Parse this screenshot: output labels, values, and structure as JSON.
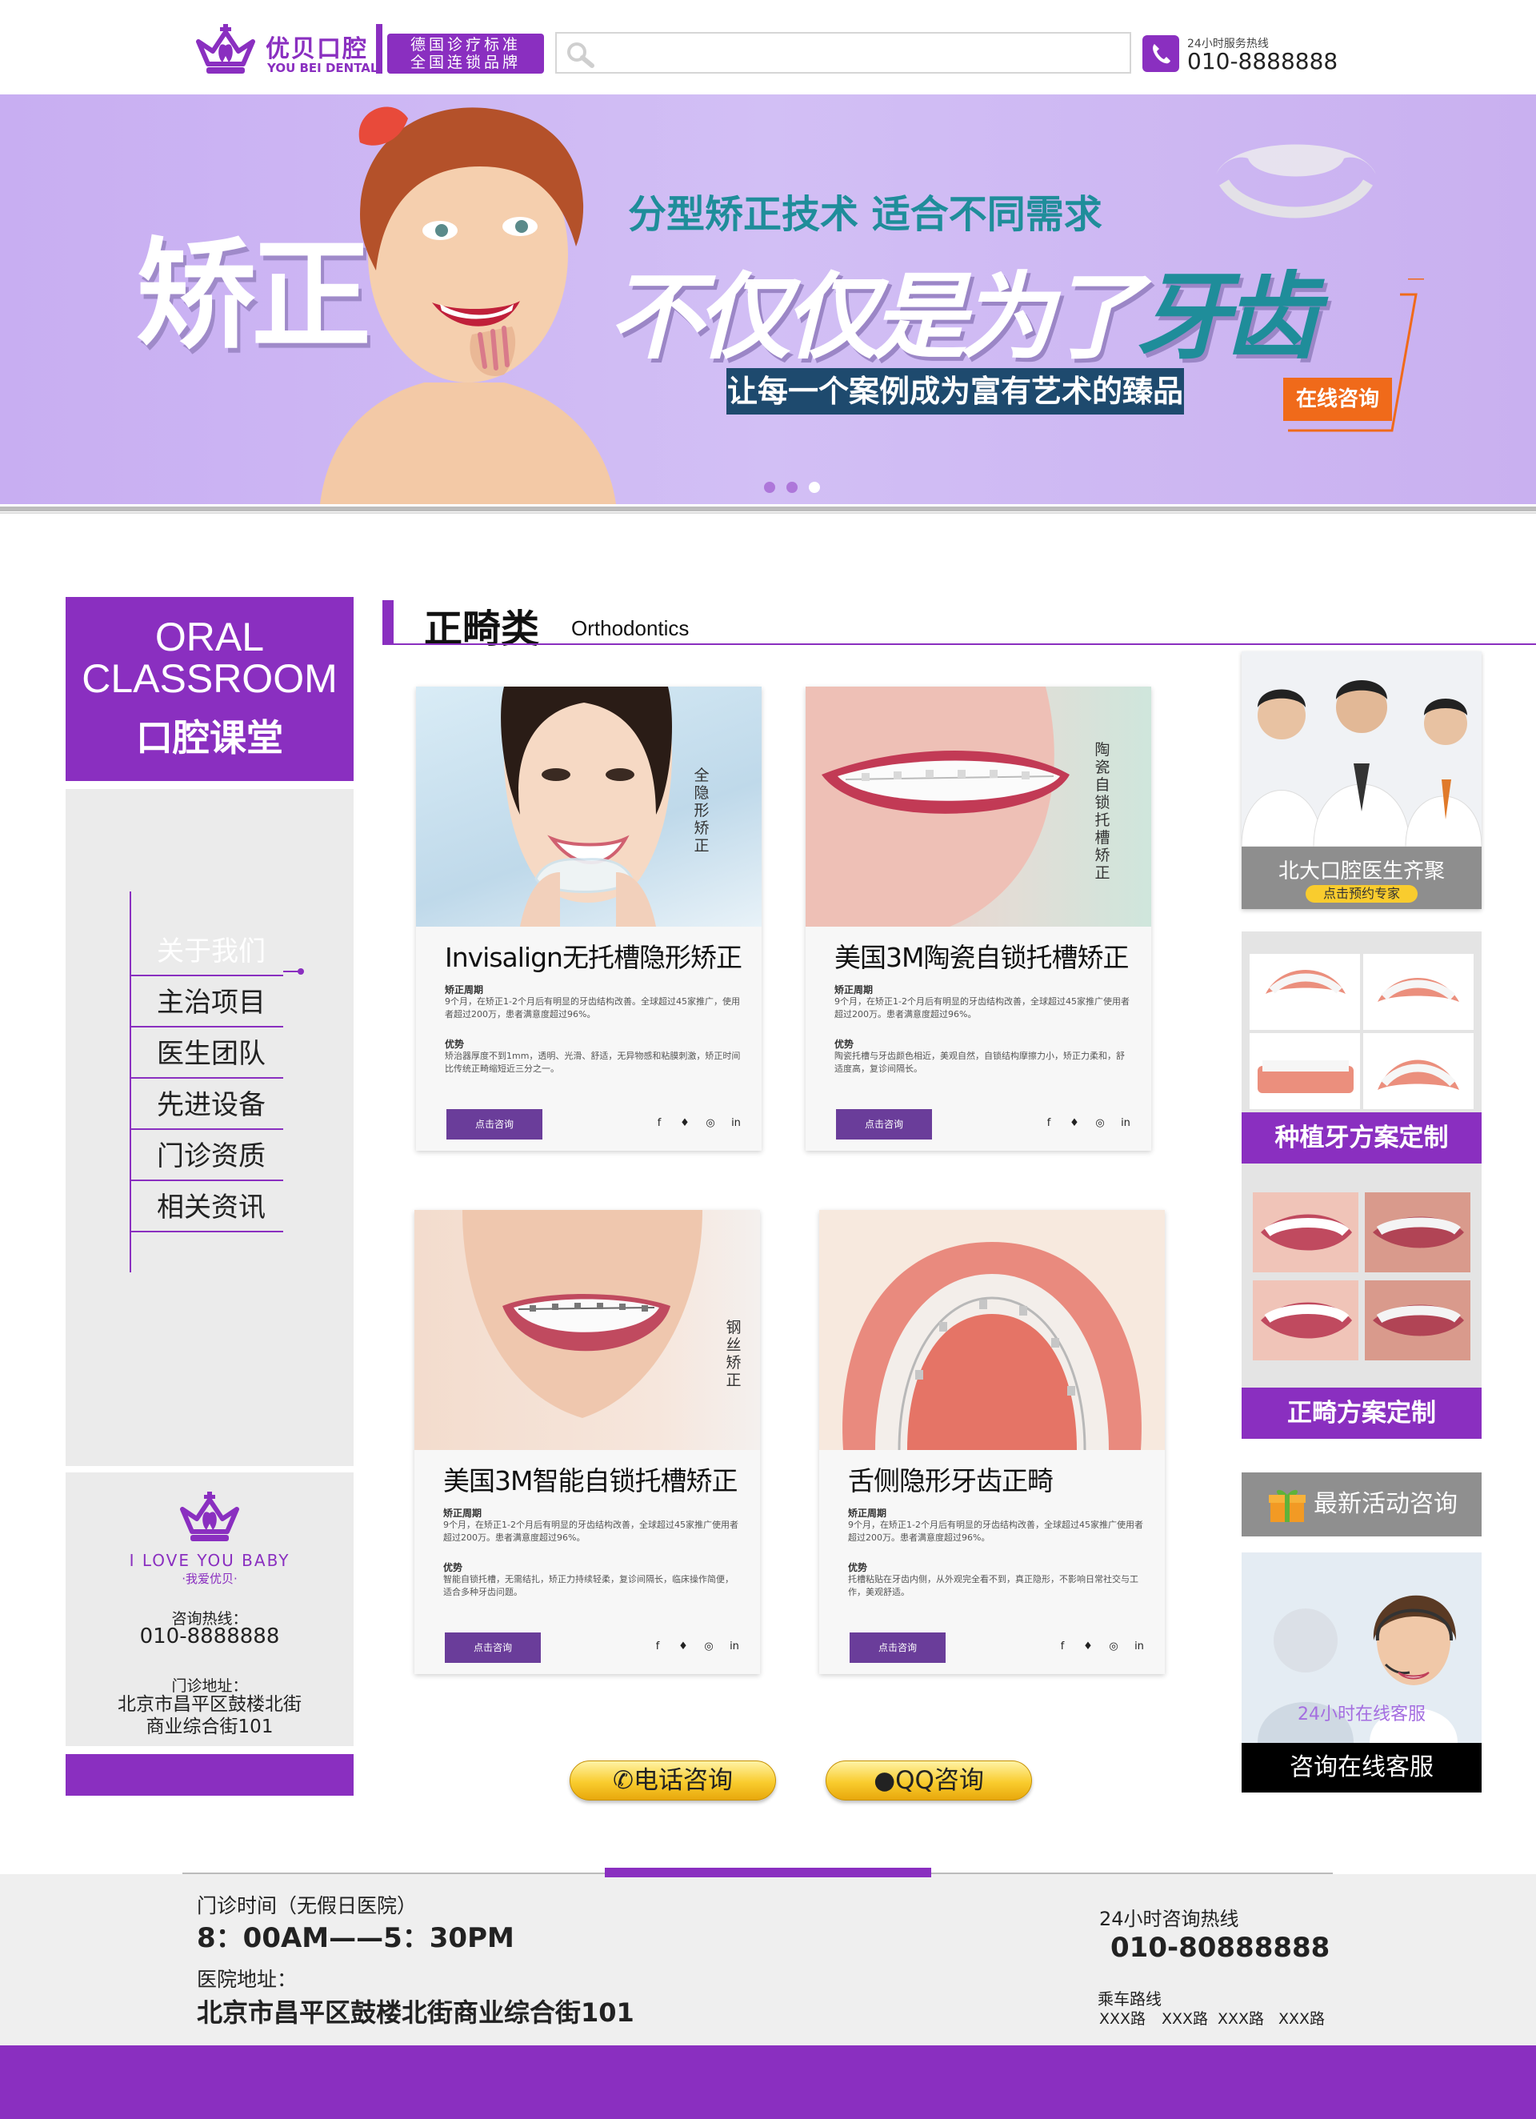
{
  "header": {
    "logo_cn": "优贝口腔",
    "logo_en": "YOU BEI DENTAL",
    "slogan_line1": "德国诊疗标准",
    "slogan_line2": "全国连锁品牌",
    "search_placeholder": "",
    "hotline_label": "24小时服务热线",
    "hotline_number": "010-8888888"
  },
  "banner": {
    "big_left": "矫正",
    "subtitle": "分型矫正技术  适合不同需求",
    "headline_part1": "不仅仅是为了",
    "headline_part2": "牙齿",
    "tagline": "让每一个案例成为富有艺术的臻品",
    "cta": "在线咨询",
    "dots": 3,
    "active_dot": 3
  },
  "sidebar": {
    "classroom_en_line1": "ORAL",
    "classroom_en_line2": "CLASSROOM",
    "classroom_cn": "口腔课堂",
    "nav": [
      {
        "label": "关于我们",
        "active": true
      },
      {
        "label": "主治项目",
        "active": false
      },
      {
        "label": "医生团队",
        "active": false
      },
      {
        "label": "先进设备",
        "active": false
      },
      {
        "label": "门诊资质",
        "active": false
      },
      {
        "label": "相关资讯",
        "active": false
      }
    ],
    "contact": {
      "tag": "I LOVE YOU BABY",
      "tag_cn": "·我爱优贝·",
      "hotline_label": "咨询热线：",
      "hotline": "010-8888888",
      "address_label": "门诊地址：",
      "address_line1": "北京市昌平区鼓楼北街",
      "address_line2": "商业综合街101"
    }
  },
  "section": {
    "title": "正畸类",
    "subtitle": "Orthodontics"
  },
  "cards": [
    {
      "vtag": "全隐形矫正",
      "title": "Invisalign无托槽隐形矫正",
      "label1": "矫正周期",
      "text1": "9个月，在矫正1-2个月后有明显的牙齿结构改善。全球超过45家推广，使用者超过200万，患者满意度超过96%。",
      "label2": "优势",
      "text2": "矫治器厚度不到1mm，透明、光滑、舒适，无异物感和粘膜刺激，矫正时间比传统正畸缩短近三分之一。",
      "button": "点击咨询"
    },
    {
      "vtag": "陶瓷自锁托槽矫正",
      "title": "美国3M陶瓷自锁托槽矫正",
      "label1": "矫正周期",
      "text1": "9个月，在矫正1-2个月后有明显的牙齿结构改善，全球超过45家推广使用者超过200万。患者满意度超过96%。",
      "label2": "优势",
      "text2": "陶瓷托槽与牙齿颜色相近，美观自然，自锁结构摩擦力小，矫正力柔和，舒适度高，复诊间隔长。",
      "button": "点击咨询"
    },
    {
      "vtag": "钢丝矫正",
      "title": "美国3M智能自锁托槽矫正",
      "label1": "矫正周期",
      "text1": "9个月，在矫正1-2个月后有明显的牙齿结构改善，全球超过45家推广使用者超过200万。患者满意度超过96%。",
      "label2": "优势",
      "text2": "智能自锁托槽，无需结扎，矫正力持续轻柔，复诊间隔长，临床操作简便，适合多种牙齿问题。",
      "button": "点击咨询"
    },
    {
      "vtag": "",
      "title": "舌侧隐形牙齿正畸",
      "label1": "矫正周期",
      "text1": "9个月，在矫正1-2个月后有明显的牙齿结构改善，全球超过45家推广使用者超过200万。患者满意度超过96%。",
      "label2": "优势",
      "text2": "托槽粘贴在牙齿内侧，从外观完全看不到，真正隐形，不影响日常社交与工作，美观舒适。",
      "button": "点击咨询"
    }
  ],
  "consult_buttons": {
    "phone": "电话咨询",
    "qq": "QQ咨询"
  },
  "right_column": {
    "doctors_caption": "北大口腔医生齐聚",
    "doctors_cta": "点击预约专家",
    "implant_title": "种植牙方案定制",
    "ortho_title": "正畸方案定制",
    "activity": "最新活动咨询",
    "service_caption": "24小时在线客服",
    "service_title": "咨询在线客服"
  },
  "footer": {
    "hours_label": "门诊时间（无假日医院）",
    "hours_value": "8：00AM——5：30PM",
    "address_label": "医院地址：",
    "address_value": "北京市昌平区鼓楼北街商业综合街101",
    "hotline_label": "24小时咨询热线",
    "hotline_value": "010-80888888",
    "routes_label": "乘车路线",
    "routes": [
      "XXX路",
      "XXX路",
      "XXX路",
      "XXX路"
    ]
  },
  "colors": {
    "brand": "#8a2fc0",
    "banner_bg": "#d2bff5",
    "teal": "#1f8d9a",
    "orange": "#f06a1a",
    "consult_yellow": "#f9cc2e"
  }
}
